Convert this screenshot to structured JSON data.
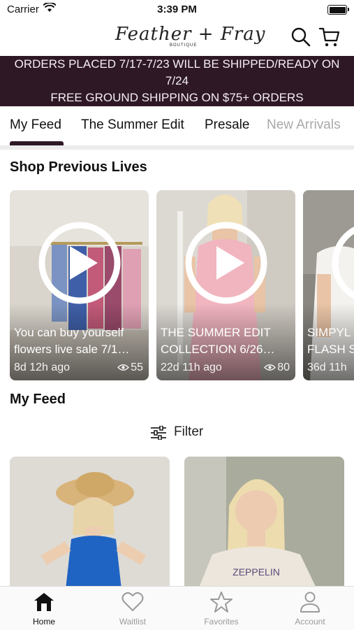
{
  "status": {
    "carrier": "Carrier",
    "time": "3:39 PM"
  },
  "header": {
    "logo_main": "Feather + Fray",
    "logo_sub": "BOUTIQUE"
  },
  "banner": {
    "line1": "ORDERS PLACED 7/17-7/23 WILL BE SHIPPED/READY ON",
    "line2": "7/24",
    "line3": "FREE GROUND SHIPPING ON $75+ ORDERS",
    "bg_color": "#2e1826"
  },
  "tabs": [
    {
      "label": "My Feed",
      "active": true
    },
    {
      "label": "The Summer Edit"
    },
    {
      "label": "Presale"
    },
    {
      "label": "New Arrivals"
    }
  ],
  "previous_lives": {
    "title": "Shop Previous Lives",
    "items": [
      {
        "title_line1": "You can buy yourself",
        "title_line2": "flowers live sale 7/1…",
        "ago": "8d 12h ago",
        "views": "55"
      },
      {
        "title_line1": "THE SUMMER EDIT",
        "title_line2": "COLLECTION  6/26…",
        "ago": "22d 11h ago",
        "views": "80"
      },
      {
        "title_line1": "SIMPYL",
        "title_line2": "FLASH S",
        "ago": "36d 11h",
        "views": ""
      }
    ]
  },
  "feed": {
    "title": "My Feed",
    "filter_label": "Filter"
  },
  "tabbar": [
    {
      "label": "Home",
      "icon": "home-icon",
      "active": true
    },
    {
      "label": "Waitlist",
      "icon": "heart-icon"
    },
    {
      "label": "Favorites",
      "icon": "star-icon"
    },
    {
      "label": "Account",
      "icon": "person-icon"
    }
  ],
  "colors": {
    "accent": "#2e1826",
    "inactive": "#9a9a9a"
  }
}
